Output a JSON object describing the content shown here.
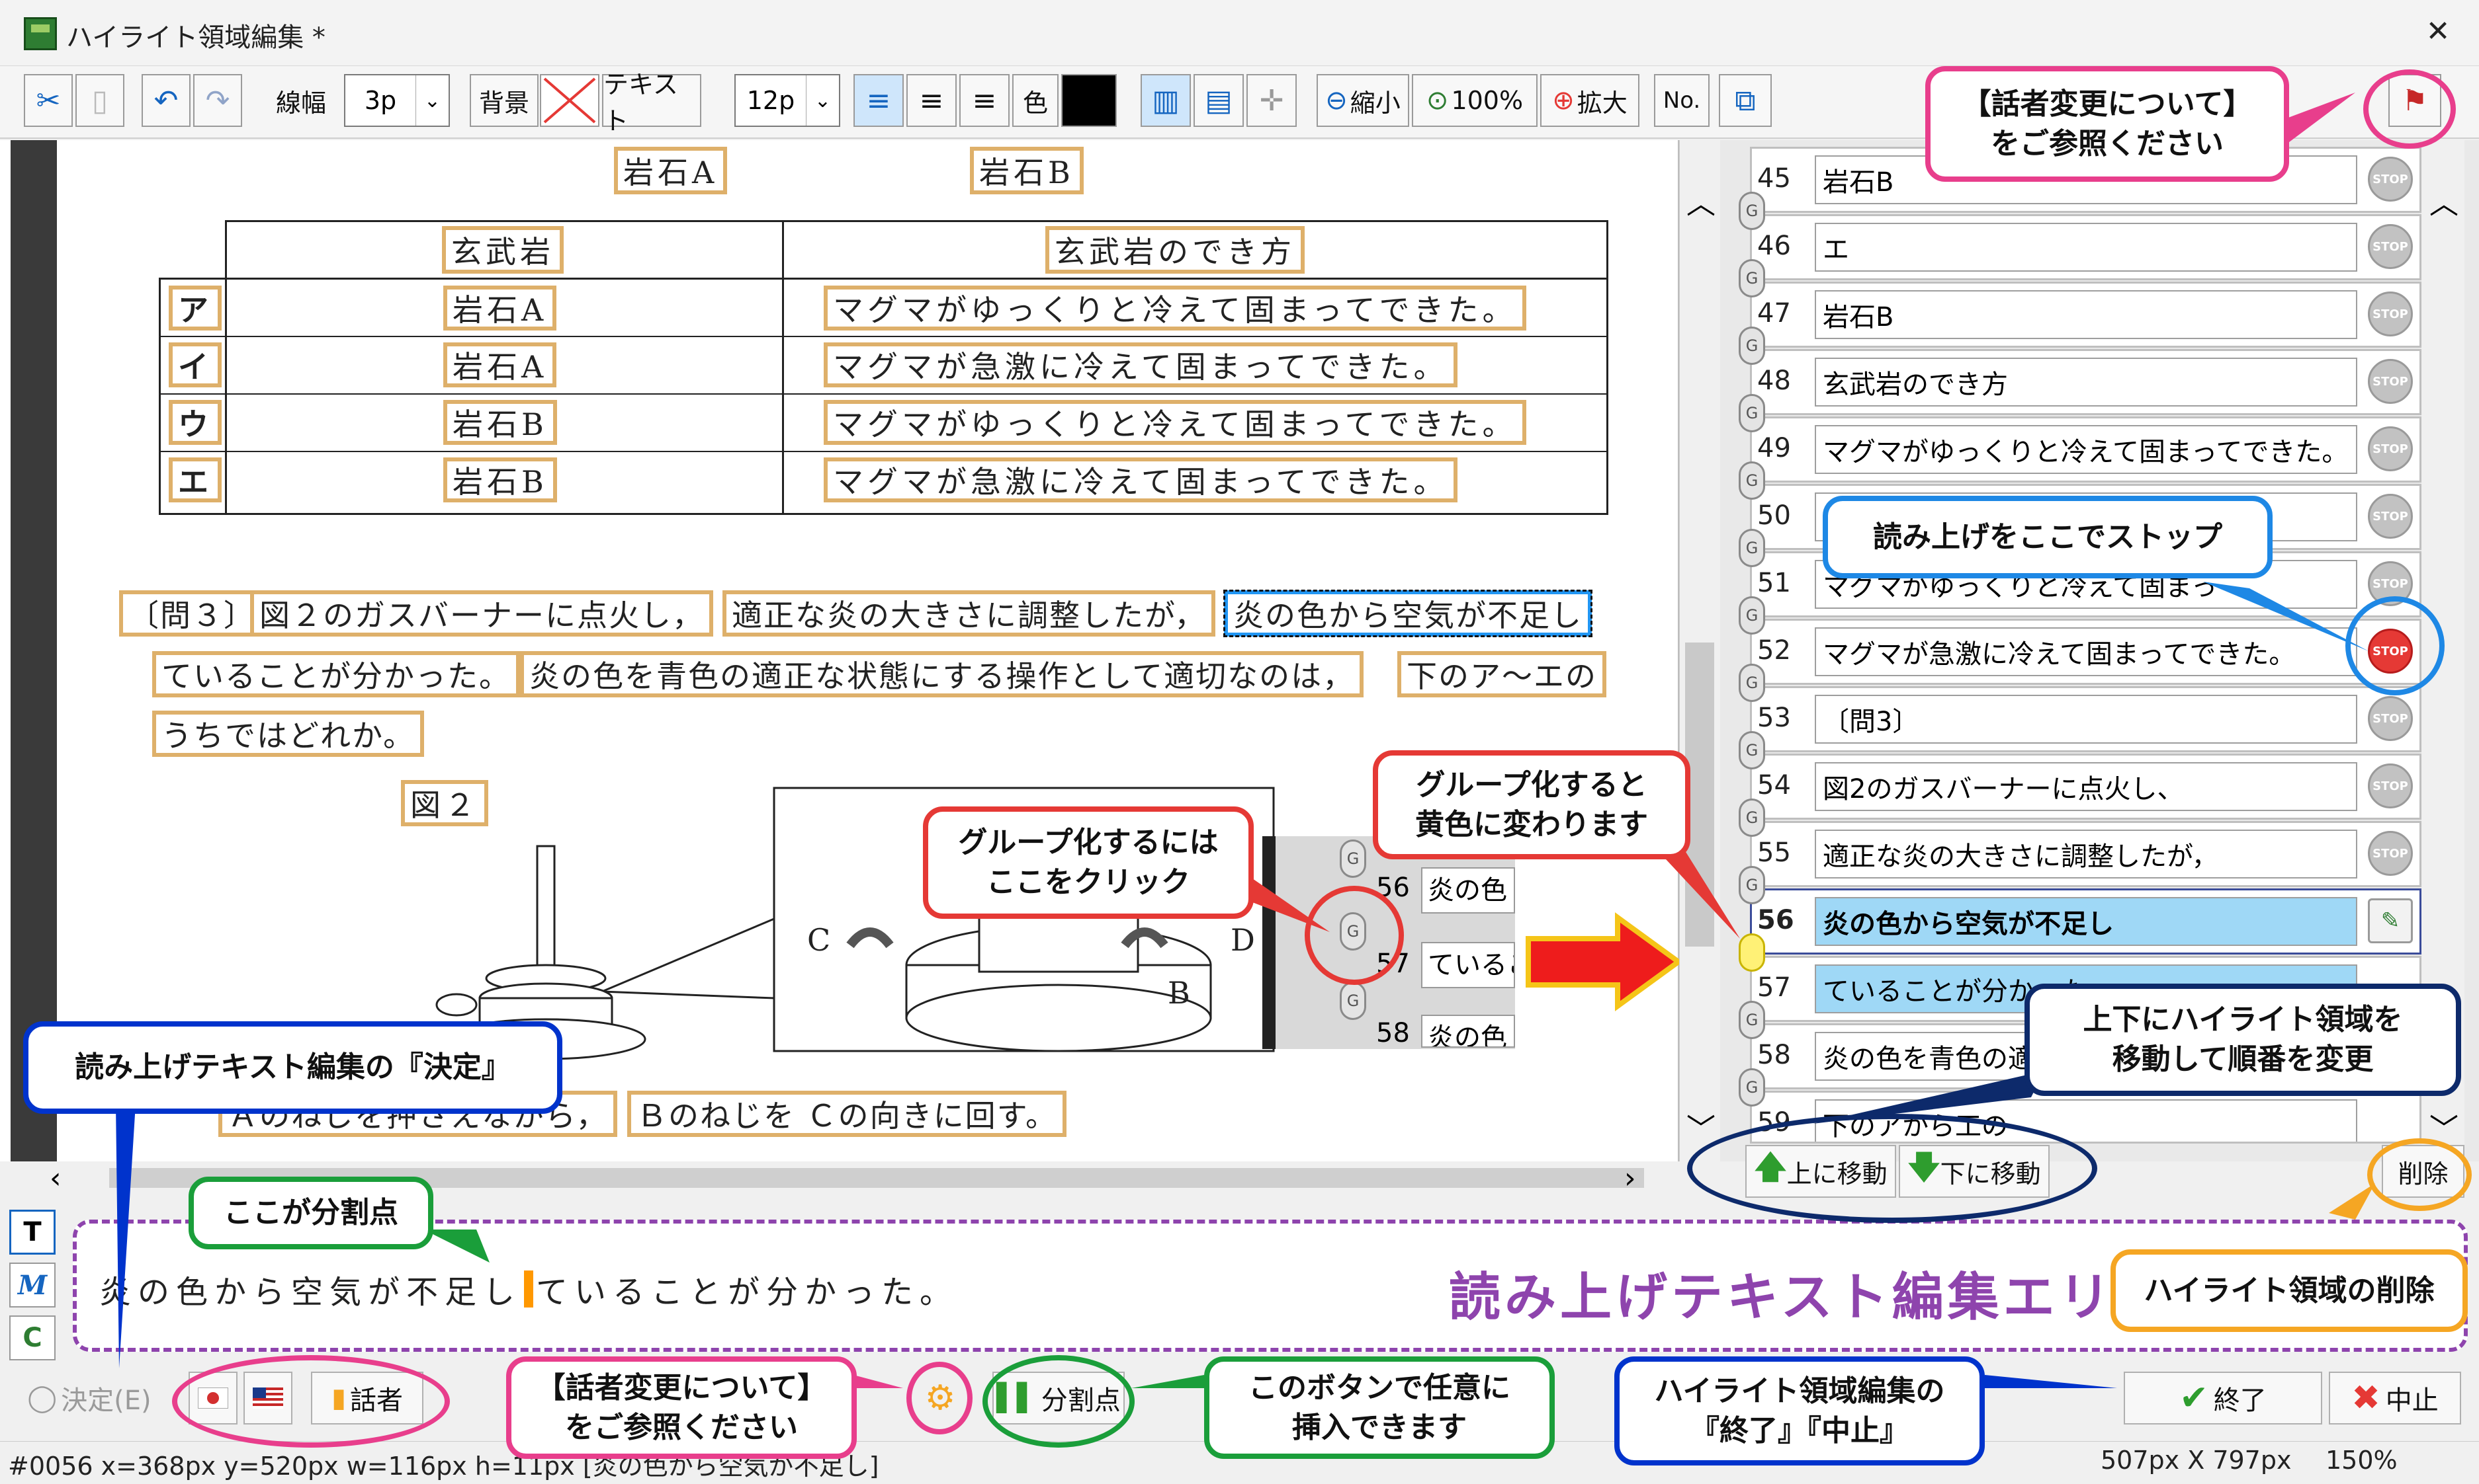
{
  "window": {
    "title": "ハイライト領域編集 *",
    "close": "✕"
  },
  "toolbar": {
    "line_width_label": "線幅",
    "line_width_value": "3p",
    "background_label": "背景",
    "text_label": "テキスト",
    "font_size_value": "12p",
    "color_label": "色",
    "zoom_out_label": "縮小",
    "zoom_value_label": "100%",
    "zoom_in_label": "拡大",
    "number_label": "No."
  },
  "document": {
    "rock_a_header": "岩石A",
    "rock_b_header": "岩石B",
    "table": {
      "col1_header": "玄武岩",
      "col2_header": "玄武岩のでき方",
      "rows": [
        {
          "label": "ア",
          "rock": "岩石A",
          "desc": "マグマがゆっくりと冷えて固まってできた。"
        },
        {
          "label": "イ",
          "rock": "岩石A",
          "desc": "マグマが急激に冷えて固まってできた。"
        },
        {
          "label": "ウ",
          "rock": "岩石B",
          "desc": "マグマがゆっくりと冷えて固まってできた。"
        },
        {
          "label": "エ",
          "rock": "岩石B",
          "desc": "マグマが急激に冷えて固まってできた。"
        }
      ]
    },
    "question": {
      "q_tag": "〔問３〕",
      "seg1": "図２のガスバーナーに点火し，",
      "seg2": "適正な炎の大きさに調整したが，",
      "seg3": "炎の色から空気が不足し",
      "seg4": "ていることが分かった。",
      "seg5": "炎の色を青色の適正な状態にする操作として適切なのは，",
      "seg6": "下のア～エの",
      "seg7": "うちではどれか。"
    },
    "figure_label": "図２",
    "fig_c": "C",
    "fig_d": "D",
    "fig_b": "B",
    "inset_items": [
      {
        "num": "56",
        "text": "炎の色"
      },
      {
        "num": "57",
        "text": "ているこ"
      },
      {
        "num": "58",
        "text": "炎の色"
      }
    ],
    "answer_seg1": "Ａのねじを押さえながら，",
    "answer_seg2": "Ｂのねじを Ｃの向きに回す。"
  },
  "list": {
    "items": [
      {
        "num": "45",
        "text": "岩石B"
      },
      {
        "num": "46",
        "text": "エ"
      },
      {
        "num": "47",
        "text": "岩石B"
      },
      {
        "num": "48",
        "text": "玄武岩のでき方"
      },
      {
        "num": "49",
        "text": "マグマがゆっくりと冷えて固まってできた。"
      },
      {
        "num": "50",
        "text": ""
      },
      {
        "num": "51",
        "text": "マグマがゆっくりと冷えて固まっ"
      },
      {
        "num": "52",
        "text": "マグマが急激に冷えて固まってできた。"
      },
      {
        "num": "53",
        "text": "〔問3〕"
      },
      {
        "num": "54",
        "text": "図2のガスバーナーに点火し、"
      },
      {
        "num": "55",
        "text": "適正な炎の大きさに調整したが，"
      },
      {
        "num": "56",
        "text": "炎の色から空気が不足し"
      },
      {
        "num": "57",
        "text": "ていることが分かった"
      },
      {
        "num": "58",
        "text": "炎の色を青色の適"
      },
      {
        "num": "59",
        "text": "下のアから工の"
      }
    ],
    "stop_label": "STOP",
    "move_up_label": "上に移動",
    "move_down_label": "下に移動",
    "delete_label": "削除"
  },
  "editor": {
    "text_before": "炎の色から空気が不足し",
    "text_after": "ていることが分かった。",
    "area_label": "読み上げテキスト編集エリア",
    "side_t": "T",
    "side_m": "M",
    "side_c": "C"
  },
  "bottom": {
    "decide_label": "決定(E)",
    "speaker_label": "話者",
    "split_label": "分割点",
    "finish_label": "終了",
    "cancel_label": "中止"
  },
  "status": {
    "info": "#0056 x=368px y=520px w=116px h=11px [炎の色から空気が不足し]",
    "size": "507px X 797px",
    "zoom": "150%"
  },
  "callouts": {
    "speaker_top": "【話者変更について】\nをご参照ください",
    "stop_here": "読み上げをここでストップ",
    "group_click": "グループ化するには\nここをクリック",
    "group_yellow": "グループ化すると\n黄色に変わります",
    "reorder": "上下にハイライト領域を\n移動して順番を変更",
    "decide_note": "読み上げテキスト編集の『決定』",
    "split_here": "ここが分割点",
    "delete_note": "ハイライト領域の削除",
    "speaker_bottom": "【話者変更について】\nをご参照ください",
    "split_button_note": "このボタンで任意に\n挿入できます",
    "finish_note": "ハイライト領域編集の\n『終了』『中止』"
  },
  "colors": {
    "highlight_border": "#deb06a",
    "selection": "#2196f3",
    "edit_area": "#8e44ad",
    "active_row": "#9fd8f6"
  }
}
